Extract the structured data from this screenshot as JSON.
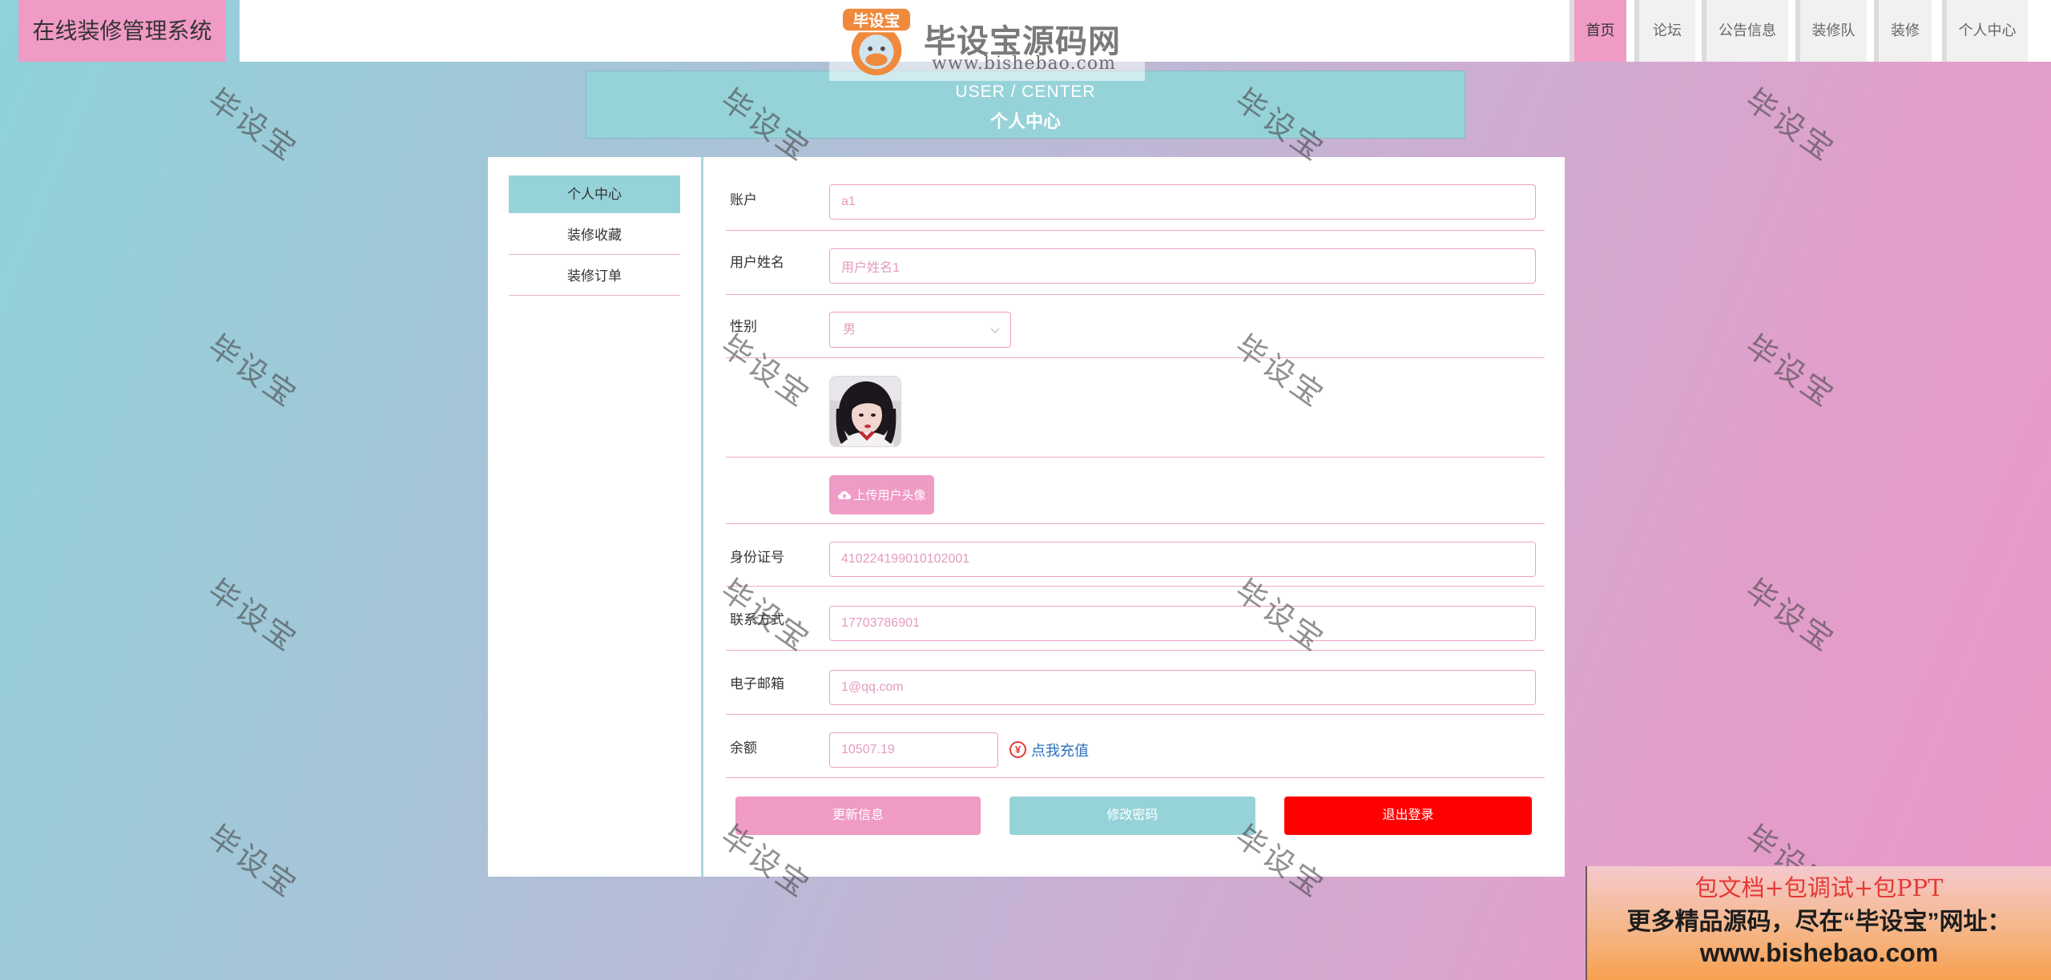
{
  "site_title": "在线装修管理系统",
  "logo": {
    "badge": "毕设宝",
    "name": "毕设宝源码网",
    "url": "www.bishebao.com"
  },
  "nav": {
    "active": 0,
    "items": [
      {
        "label": "首页"
      },
      {
        "label": "论坛"
      },
      {
        "label": "公告信息"
      },
      {
        "label": "装修队"
      },
      {
        "label": "装修"
      },
      {
        "label": "个人中心"
      }
    ]
  },
  "page_header": {
    "en": "USER / CENTER",
    "cn": "个人中心"
  },
  "sidebar": {
    "active": 0,
    "items": [
      {
        "label": "个人中心"
      },
      {
        "label": "装修收藏"
      },
      {
        "label": "装修订单"
      }
    ]
  },
  "form": {
    "account": {
      "label": "账户",
      "value": "a1"
    },
    "name": {
      "label": "用户姓名",
      "value": "用户姓名1"
    },
    "gender": {
      "label": "性别",
      "value": "男"
    },
    "avatar": {
      "upload_label": "上传用户头像"
    },
    "id_card": {
      "label": "身份证号",
      "value": "410224199010102001"
    },
    "phone": {
      "label": "联系方式",
      "value": "17703786901"
    },
    "email": {
      "label": "电子邮箱",
      "value": "1@qq.com"
    },
    "balance": {
      "label": "余额",
      "value": "10507.19",
      "currency_symbol": "¥",
      "recharge_label": "点我充值"
    }
  },
  "actions": {
    "update": "更新信息",
    "change_password": "修改密码",
    "logout": "退出登录"
  },
  "watermark": {
    "text": "毕设宝"
  },
  "promo": {
    "line1": "包文档+包调试+包PPT",
    "line2": "更多精品源码，尽在“毕设宝”网址：",
    "line3": "www.bishebao.com"
  },
  "icons": {
    "select": "chevron-down-icon",
    "upload": "cloud-upload-icon",
    "balance": "yen-circle-icon"
  },
  "colors": {
    "pink": "#f09ac6",
    "teal": "#96d3d9",
    "red": "#ff0000",
    "link": "#2a6fbd"
  }
}
